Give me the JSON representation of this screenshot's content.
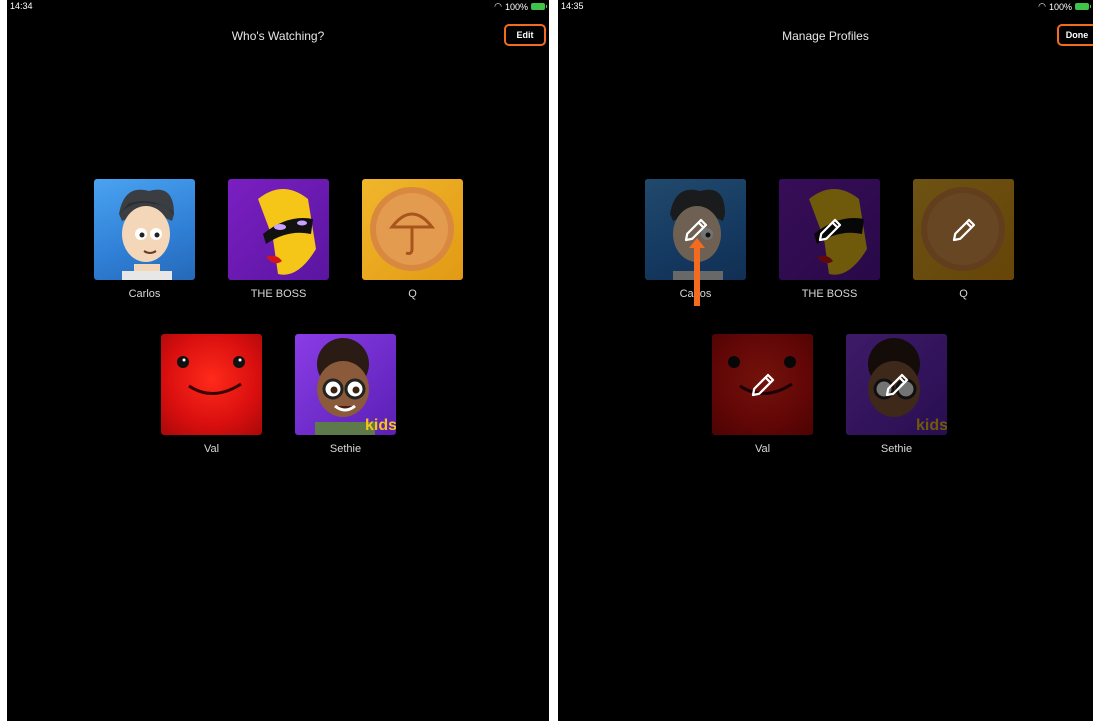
{
  "left": {
    "status": {
      "time": "14:34",
      "battery": "100%"
    },
    "title": "Who's Watching?",
    "edit_label": "Edit",
    "profiles": [
      {
        "name": "Carlos"
      },
      {
        "name": "THE BOSS"
      },
      {
        "name": "Q"
      },
      {
        "name": "Val"
      },
      {
        "name": "Sethie",
        "badge": "kids"
      }
    ]
  },
  "right": {
    "status": {
      "time": "14:35",
      "battery": "100%"
    },
    "title": "Manage Profiles",
    "done_label": "Done",
    "profiles": [
      {
        "name": "Carlos"
      },
      {
        "name": "THE BOSS"
      },
      {
        "name": "Q"
      },
      {
        "name": "Val"
      },
      {
        "name": "Sethie",
        "badge": "kids"
      }
    ]
  },
  "colors": {
    "highlight": "#f26b21",
    "background": "#000000"
  }
}
